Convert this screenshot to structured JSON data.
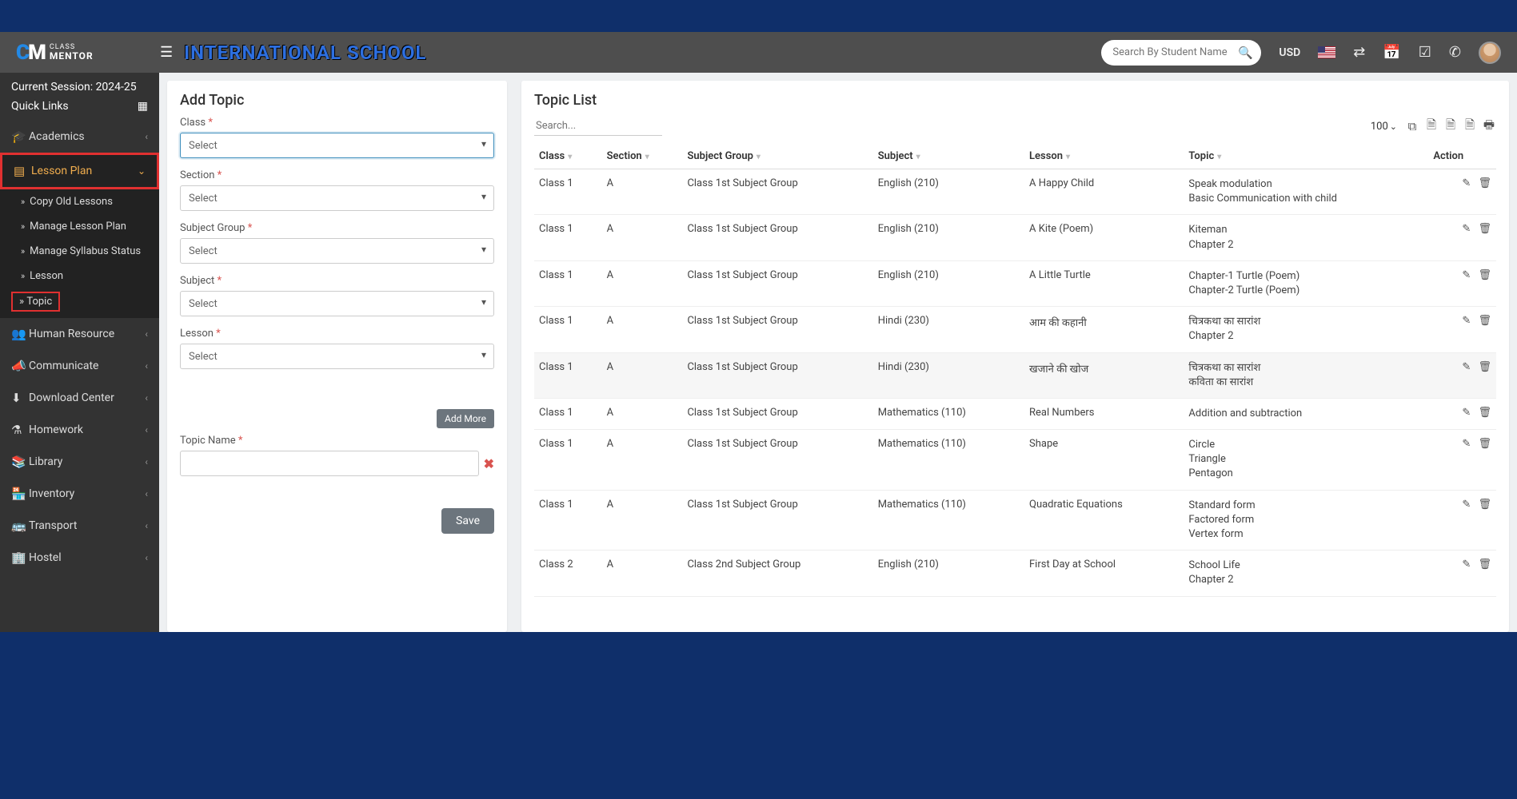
{
  "header": {
    "logo_brand_top": "CLASS",
    "logo_brand_bottom": "MENTOR",
    "school_name": "INTERNATIONAL SCHOOL",
    "search_placeholder": "Search By Student Name",
    "currency": "USD"
  },
  "sidebar": {
    "session": "Current Session: 2024-25",
    "quick_links": "Quick Links",
    "items": [
      {
        "icon": "🎓",
        "label": "Academics"
      },
      {
        "icon": "▤",
        "label": "Lesson Plan",
        "expanded": true,
        "children": [
          {
            "label": "Copy Old Lessons"
          },
          {
            "label": "Manage Lesson Plan"
          },
          {
            "label": "Manage Syllabus Status"
          },
          {
            "label": "Lesson"
          },
          {
            "label": "Topic",
            "active": true
          }
        ]
      },
      {
        "icon": "👥",
        "label": "Human Resource"
      },
      {
        "icon": "📣",
        "label": "Communicate"
      },
      {
        "icon": "⬇",
        "label": "Download Center"
      },
      {
        "icon": "⚗",
        "label": "Homework"
      },
      {
        "icon": "📚",
        "label": "Library"
      },
      {
        "icon": "🏪",
        "label": "Inventory"
      },
      {
        "icon": "🚌",
        "label": "Transport"
      },
      {
        "icon": "🏢",
        "label": "Hostel"
      }
    ]
  },
  "form": {
    "title": "Add Topic",
    "class_label": "Class",
    "section_label": "Section",
    "subject_group_label": "Subject Group",
    "subject_label": "Subject",
    "lesson_label": "Lesson",
    "select_placeholder": "Select",
    "add_more": "Add More",
    "topic_name_label": "Topic Name",
    "save": "Save"
  },
  "list": {
    "title": "Topic List",
    "search_placeholder": "Search...",
    "page_size": "100",
    "columns": {
      "class": "Class",
      "section": "Section",
      "subject_group": "Subject Group",
      "subject": "Subject",
      "lesson": "Lesson",
      "topic": "Topic",
      "action": "Action"
    },
    "rows": [
      {
        "class": "Class 1",
        "section": "A",
        "subject_group": "Class 1st Subject Group",
        "subject": "English (210)",
        "lesson": "A Happy Child",
        "topic": "Speak modulation\nBasic Communication with child"
      },
      {
        "class": "Class 1",
        "section": "A",
        "subject_group": "Class 1st Subject Group",
        "subject": "English (210)",
        "lesson": "A Kite (Poem)",
        "topic": "Kiteman\nChapter 2"
      },
      {
        "class": "Class 1",
        "section": "A",
        "subject_group": "Class 1st Subject Group",
        "subject": "English (210)",
        "lesson": "A Little Turtle",
        "topic": "Chapter-1 Turtle (Poem)\nChapter-2 Turtle (Poem)"
      },
      {
        "class": "Class 1",
        "section": "A",
        "subject_group": "Class 1st Subject Group",
        "subject": "Hindi (230)",
        "lesson": "आम की कहानी",
        "topic": "चित्रकथा का सारांश\nChapter 2"
      },
      {
        "class": "Class 1",
        "section": "A",
        "subject_group": "Class 1st Subject Group",
        "subject": "Hindi (230)",
        "lesson": "खजाने की खोज",
        "topic": "चित्रकथा का सारांश\nकविता का सारांश"
      },
      {
        "class": "Class 1",
        "section": "A",
        "subject_group": "Class 1st Subject Group",
        "subject": "Mathematics (110)",
        "lesson": "Real Numbers",
        "topic": "Addition and subtraction"
      },
      {
        "class": "Class 1",
        "section": "A",
        "subject_group": "Class 1st Subject Group",
        "subject": "Mathematics (110)",
        "lesson": "Shape",
        "topic": "Circle\nTriangle\nPentagon"
      },
      {
        "class": "Class 1",
        "section": "A",
        "subject_group": "Class 1st Subject Group",
        "subject": "Mathematics (110)",
        "lesson": "Quadratic Equations",
        "topic": "Standard form\nFactored form\nVertex form"
      },
      {
        "class": "Class 2",
        "section": "A",
        "subject_group": "Class 2nd Subject Group",
        "subject": "English (210)",
        "lesson": "First Day at School",
        "topic": "School Life\nChapter 2"
      }
    ]
  }
}
